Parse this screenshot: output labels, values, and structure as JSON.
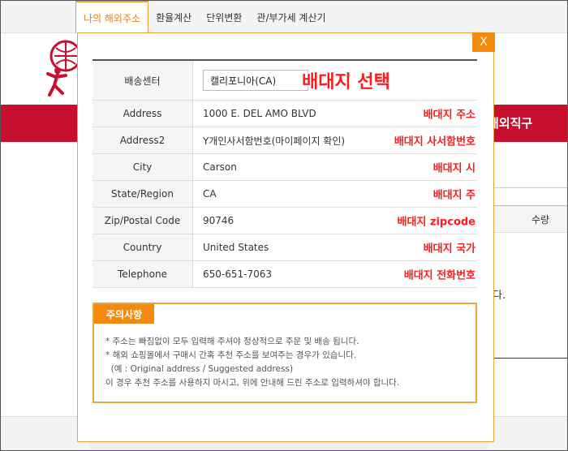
{
  "tabs": [
    {
      "label": "나의 해외주소",
      "active": true
    },
    {
      "label": "환율계산",
      "active": false
    },
    {
      "label": "단위변환",
      "active": false
    },
    {
      "label": "관/부가세 계산기",
      "active": false
    }
  ],
  "background": {
    "redbar_text": "해외직구",
    "col_head": "수량",
    "snippet": "다."
  },
  "modal": {
    "close_label": "X",
    "rows": [
      {
        "label": "배송센터",
        "value": "캘리포니아(CA)",
        "annotation": "배대지 선택"
      },
      {
        "label": "Address",
        "value": "1000 E. DEL AMO BLVD",
        "annotation": "배대지 주소"
      },
      {
        "label": "Address2",
        "value": "Y개인사서함번호(마이페이지 확인)",
        "annotation": "배대지 사서함번호"
      },
      {
        "label": "City",
        "value": "Carson",
        "annotation": "배대지 시"
      },
      {
        "label": "State/Region",
        "value": "CA",
        "annotation": "배대지 주"
      },
      {
        "label": "Zip/Postal Code",
        "value": "90746",
        "annotation": "배대지 zipcode"
      },
      {
        "label": "Country",
        "value": "United States",
        "annotation": "배대지 국가"
      },
      {
        "label": "Telephone",
        "value": "650-651-7063",
        "annotation": "배대지 전화번호"
      }
    ],
    "notice": {
      "title": "주의사항",
      "lines": [
        "* 주소는 빠짐없이 모두 입력해 주셔야 정상적으로 주문 및 배송 됩니다.",
        "* 해외 쇼핑몰에서 구매시 간혹 추천 주소를 보여주는 경우가 있습니다.",
        "  (예 : Original address / Suggested address)",
        "이 경우 추천 주소를 사용하지 마시고, 위에 안내해 드린 주소로 입력하셔야 합니다."
      ]
    }
  },
  "colors": {
    "accent": "#f28a10",
    "annotation": "#ff1a1a",
    "brand_red": "#c8102e"
  }
}
